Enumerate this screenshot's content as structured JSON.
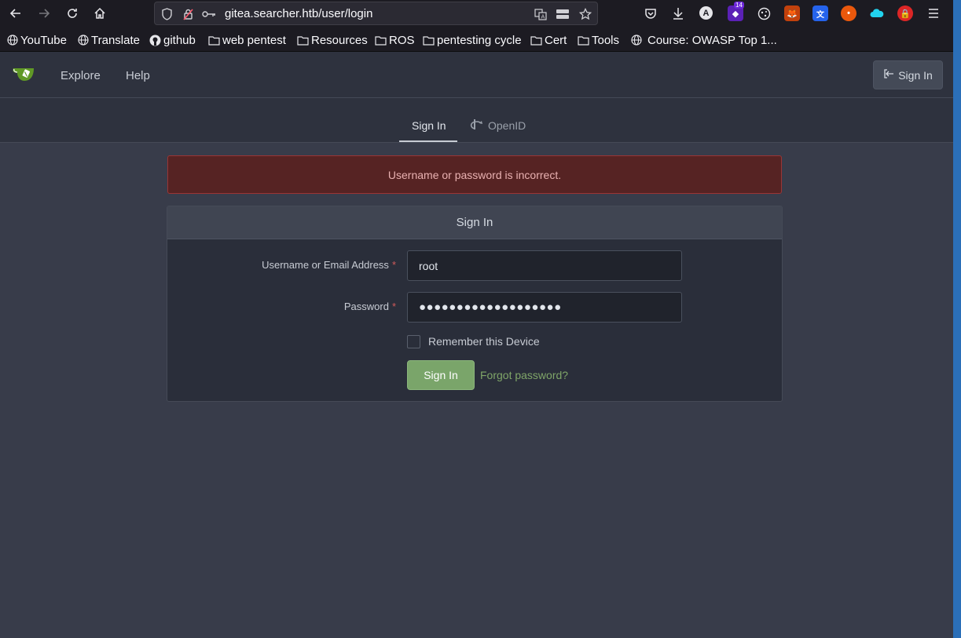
{
  "browser": {
    "url": "gitea.searcher.htb/user/login",
    "extension_badge": "14",
    "bookmarks": [
      {
        "label": "YouTube",
        "icon": "globe-icon"
      },
      {
        "label": "Translate",
        "icon": "globe-icon"
      },
      {
        "label": "github",
        "icon": "github-icon"
      },
      {
        "label": "web pentest",
        "icon": "folder-icon"
      },
      {
        "label": "Resources",
        "icon": "folder-icon"
      },
      {
        "label": "ROS",
        "icon": "folder-icon"
      },
      {
        "label": "pentesting cycle",
        "icon": "folder-icon"
      },
      {
        "label": "Cert",
        "icon": "folder-icon"
      },
      {
        "label": "Tools",
        "icon": "folder-icon"
      },
      {
        "label": "Course: OWASP Top 1...",
        "icon": "globe-icon"
      }
    ]
  },
  "gitea": {
    "nav": {
      "explore": "Explore",
      "help": "Help",
      "sign_in": "Sign In"
    },
    "tabs": {
      "sign_in": "Sign In",
      "openid": "OpenID"
    },
    "error": "Username or password is incorrect.",
    "form": {
      "header": "Sign In",
      "username_label": "Username or Email Address",
      "username_value": "root",
      "password_label": "Password",
      "password_value": "●●●●●●●●●●●●●●●●●●●",
      "required_mark": "*",
      "remember_label": "Remember this Device",
      "submit_label": "Sign In",
      "forgot_label": "Forgot password?"
    },
    "colors": {
      "accent_green": "#7aa56a",
      "error_bg": "#562323"
    }
  }
}
